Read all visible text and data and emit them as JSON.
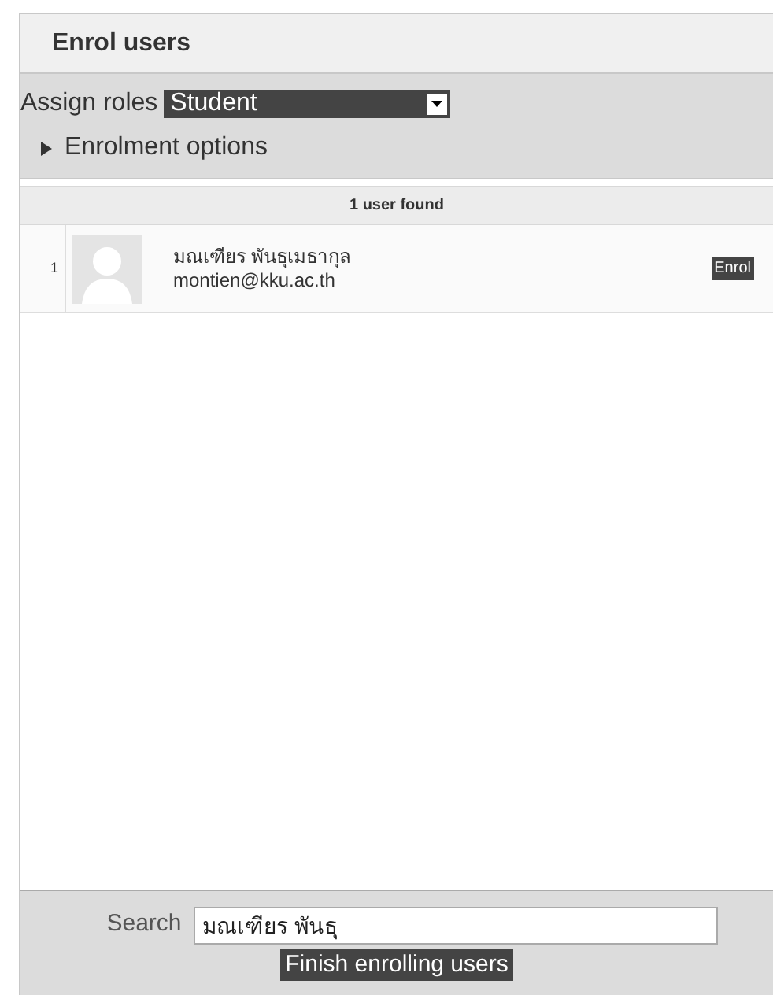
{
  "dialog": {
    "title": "Enrol users"
  },
  "assign_roles": {
    "label": "Assign roles",
    "value": "Student"
  },
  "enrolment_options": {
    "label": "Enrolment options",
    "expanded": false
  },
  "results": {
    "summary": "1 user found",
    "users": [
      {
        "index": "1",
        "name": "มณเฑียร พันธุเมธากุล",
        "email": "montien@kku.ac.th",
        "action": "Enrol"
      }
    ]
  },
  "search": {
    "label": "Search",
    "value": "มณเฑียร พันธุ"
  },
  "finish_button": "Finish enrolling users"
}
